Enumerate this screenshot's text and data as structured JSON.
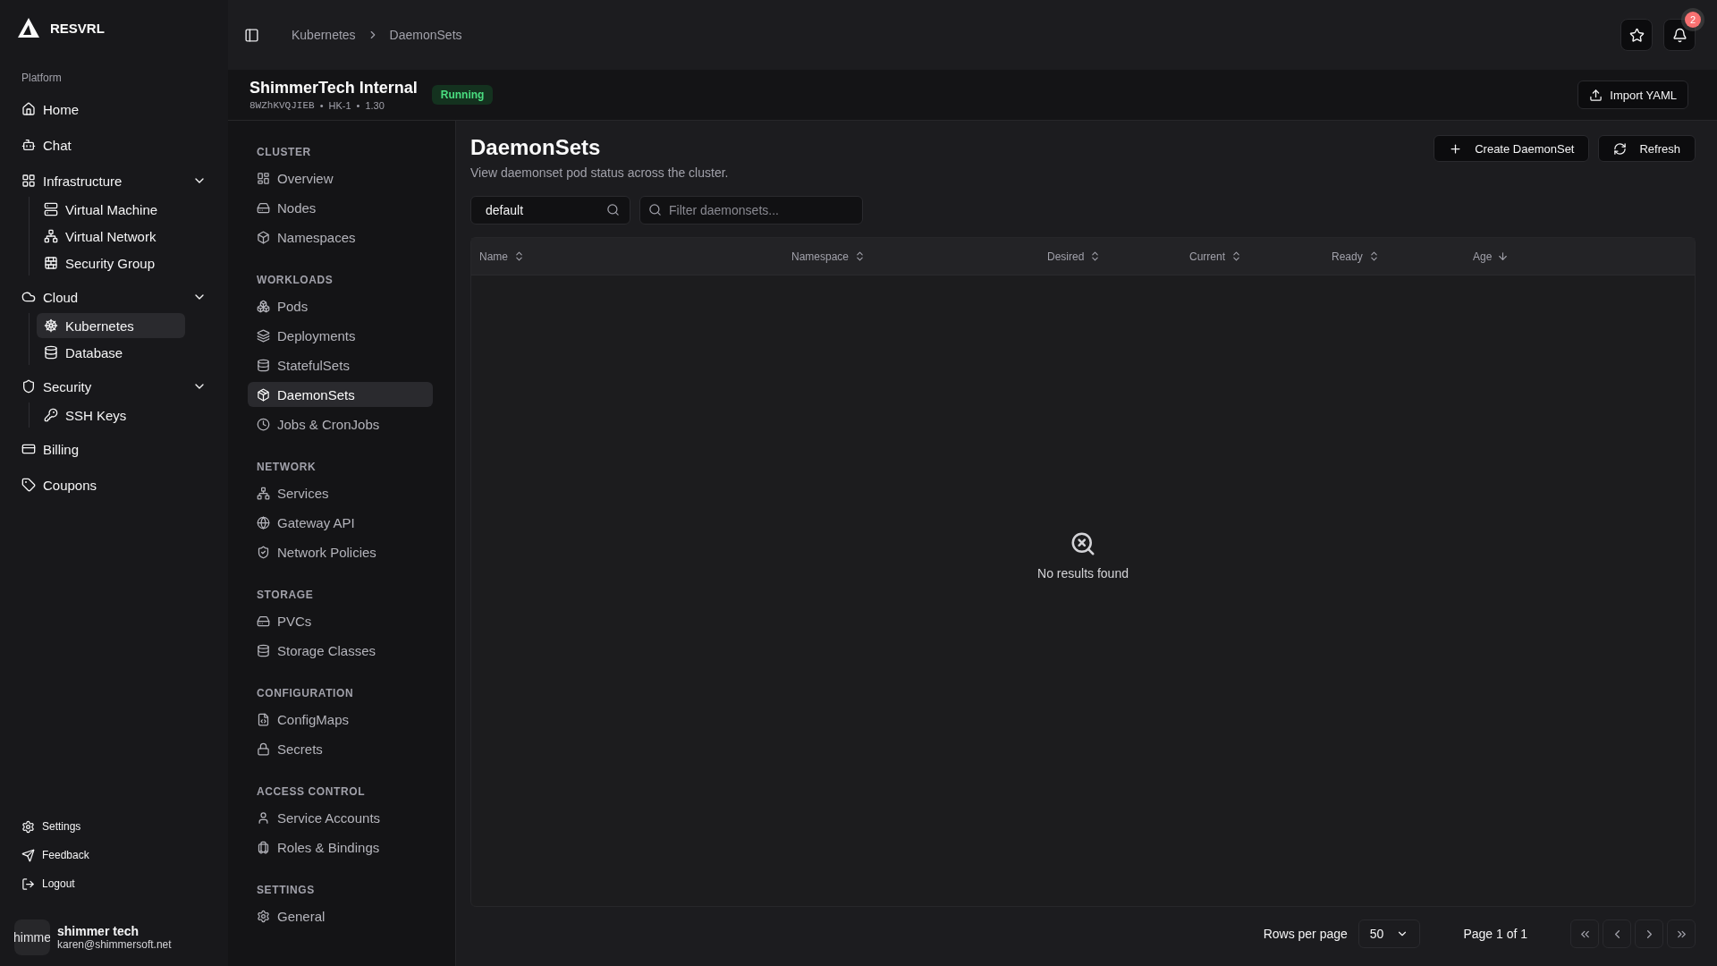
{
  "brand": {
    "name": "RESVRL"
  },
  "sidebar": {
    "section": "Platform",
    "items": [
      {
        "label": "Home",
        "selected": false
      },
      {
        "label": "Chat",
        "selected": false
      },
      {
        "label": "Infrastructure",
        "selected": false,
        "expanded": true,
        "children": [
          {
            "label": "Virtual Machine",
            "selected": false
          },
          {
            "label": "Virtual Network",
            "selected": false
          },
          {
            "label": "Security Group",
            "selected": false
          }
        ]
      },
      {
        "label": "Cloud",
        "selected": false,
        "expanded": true,
        "children": [
          {
            "label": "Kubernetes",
            "selected": true
          },
          {
            "label": "Database",
            "selected": false
          }
        ]
      },
      {
        "label": "Security",
        "selected": false,
        "expanded": true,
        "children": [
          {
            "label": "SSH Keys",
            "selected": false
          }
        ]
      },
      {
        "label": "Billing",
        "selected": false
      },
      {
        "label": "Coupons",
        "selected": false
      }
    ],
    "footer": [
      "Settings",
      "Feedback",
      "Logout"
    ],
    "user": {
      "avatar": "himme",
      "name": "shimmer tech",
      "email": "karen@shimmersoft.net"
    }
  },
  "breadcrumbs": [
    "Kubernetes",
    "DaemonSets"
  ],
  "notifications": {
    "count": "2"
  },
  "cluster": {
    "name": "ShimmerTech Internal",
    "meta": [
      {
        "kind": "id",
        "text": "8WZhKVQJIEB"
      },
      {
        "kind": "separator",
        "text": "•"
      },
      {
        "kind": "region",
        "text": "HK-1"
      },
      {
        "kind": "separator",
        "text": "•"
      },
      {
        "kind": "version",
        "text": "1.30"
      }
    ],
    "status": "Running",
    "import_button": "Import YAML"
  },
  "subnav": [
    {
      "heading": "CLUSTER",
      "items": [
        {
          "label": "Overview",
          "selected": false
        },
        {
          "label": "Nodes",
          "selected": false
        },
        {
          "label": "Namespaces",
          "selected": false
        }
      ]
    },
    {
      "heading": "WORKLOADS",
      "items": [
        {
          "label": "Pods",
          "selected": false
        },
        {
          "label": "Deployments",
          "selected": false
        },
        {
          "label": "StatefulSets",
          "selected": false
        },
        {
          "label": "DaemonSets",
          "selected": true
        },
        {
          "label": "Jobs & CronJobs",
          "selected": false
        }
      ]
    },
    {
      "heading": "NETWORK",
      "items": [
        {
          "label": "Services",
          "selected": false
        },
        {
          "label": "Gateway API",
          "selected": false
        },
        {
          "label": "Network Policies",
          "selected": false
        }
      ]
    },
    {
      "heading": "STORAGE",
      "items": [
        {
          "label": "PVCs",
          "selected": false
        },
        {
          "label": "Storage Classes",
          "selected": false
        }
      ]
    },
    {
      "heading": "CONFIGURATION",
      "items": [
        {
          "label": "ConfigMaps",
          "selected": false
        },
        {
          "label": "Secrets",
          "selected": false
        }
      ]
    },
    {
      "heading": "ACCESS CONTROL",
      "items": [
        {
          "label": "Service Accounts",
          "selected": false
        },
        {
          "label": "Roles & Bindings",
          "selected": false
        }
      ]
    },
    {
      "heading": "SETTINGS",
      "items": [
        {
          "label": "General",
          "selected": false
        }
      ]
    }
  ],
  "page": {
    "title": "DaemonSets",
    "subtitle": "View daemonset pod status across the cluster.",
    "create_button": "Create DaemonSet",
    "refresh_button": "Refresh"
  },
  "namespace_field": {
    "value": "default"
  },
  "search": {
    "placeholder": "Filter daemonsets..."
  },
  "table": {
    "columns": [
      {
        "label": "Name",
        "sorted": false
      },
      {
        "label": "Namespace",
        "sorted": false
      },
      {
        "label": "Desired",
        "sorted": false
      },
      {
        "label": "Current",
        "sorted": false
      },
      {
        "label": "Ready",
        "sorted": false
      },
      {
        "label": "Age",
        "sorted": true
      }
    ],
    "empty_text": "No results found"
  },
  "pagination": {
    "rows_label": "Rows per page",
    "rows_value": "50",
    "page_label": "Page 1 of 1"
  }
}
